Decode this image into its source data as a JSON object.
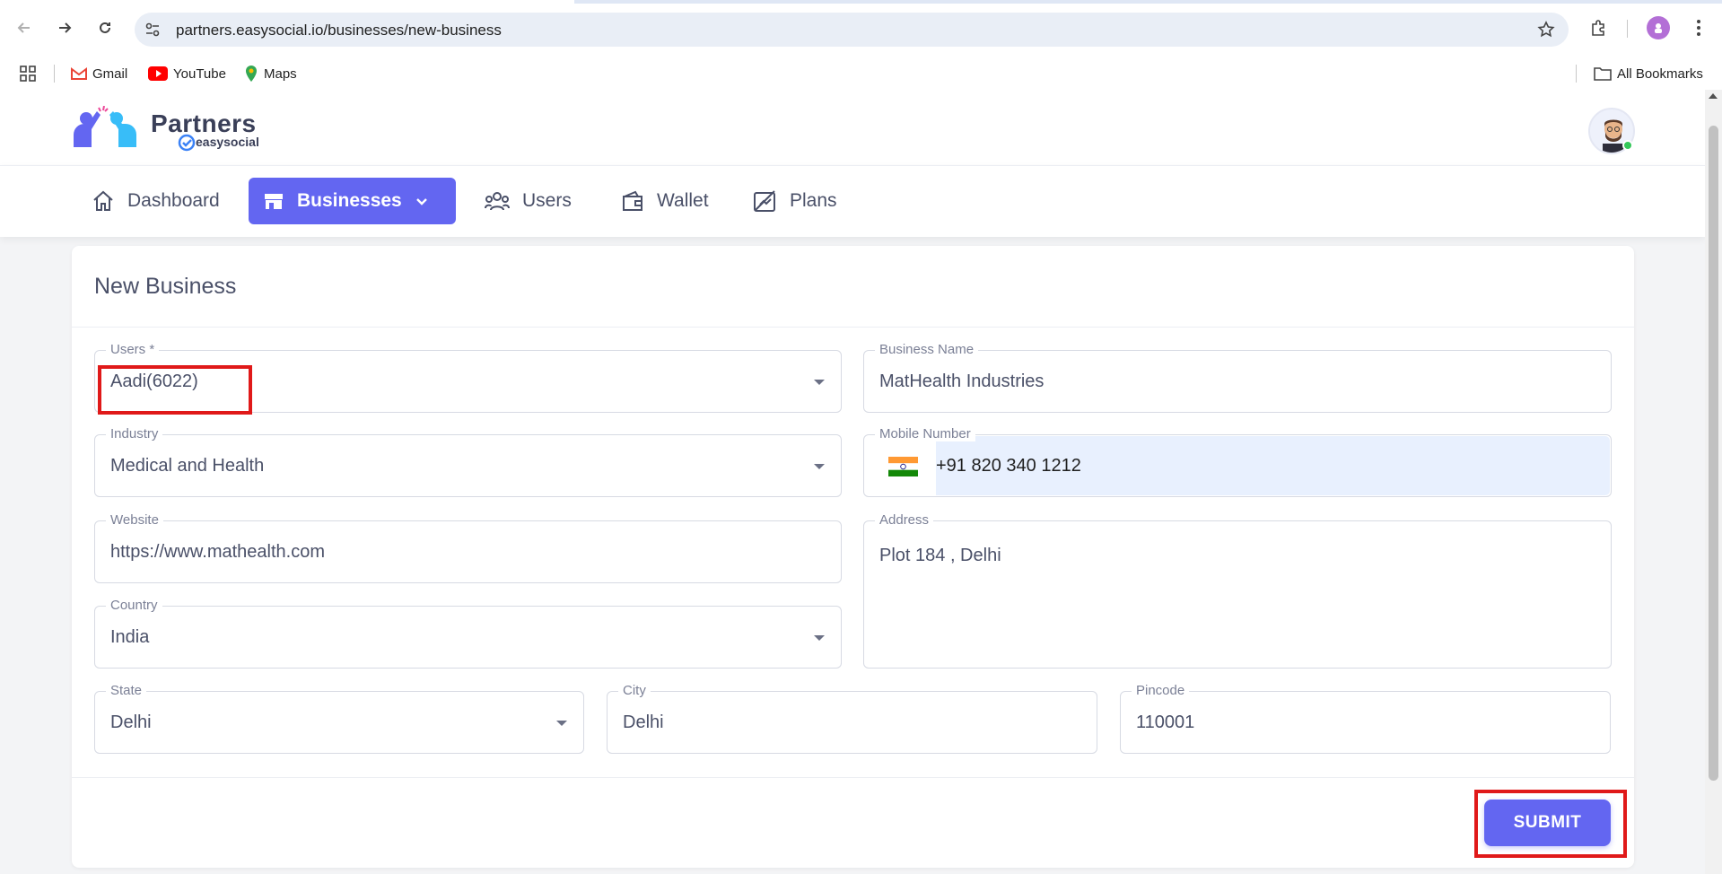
{
  "browser": {
    "url": "partners.easysocial.io/businesses/new-business",
    "bookmarks": [
      {
        "label": "Gmail",
        "icon": "gmail-icon"
      },
      {
        "label": "YouTube",
        "icon": "youtube-icon"
      },
      {
        "label": "Maps",
        "icon": "maps-icon"
      }
    ],
    "all_bookmarks": "All Bookmarks"
  },
  "header": {
    "logo_title": "Partners",
    "logo_subtitle": "easysocial"
  },
  "nav": {
    "items": [
      {
        "label": "Dashboard",
        "icon": "home-icon"
      },
      {
        "label": "Businesses",
        "icon": "store-icon",
        "active": true
      },
      {
        "label": "Users",
        "icon": "users-icon"
      },
      {
        "label": "Wallet",
        "icon": "wallet-icon"
      },
      {
        "label": "Plans",
        "icon": "plans-icon"
      }
    ]
  },
  "form": {
    "title": "New Business",
    "users": {
      "label": "Users *",
      "value": "Aadi(6022)"
    },
    "business_name": {
      "label": "Business Name",
      "value": "MatHealth Industries"
    },
    "industry": {
      "label": "Industry",
      "value": "Medical and Health"
    },
    "mobile": {
      "label": "Mobile Number",
      "value": "+91 820 340 1212"
    },
    "website": {
      "label": "Website",
      "value": "https://www.mathealth.com"
    },
    "address": {
      "label": "Address",
      "value": "Plot 184 , Delhi"
    },
    "country": {
      "label": "Country",
      "value": "India"
    },
    "state": {
      "label": "State",
      "value": "Delhi"
    },
    "city": {
      "label": "City",
      "value": "Delhi"
    },
    "pincode": {
      "label": "Pincode",
      "value": "110001"
    },
    "submit_label": "SUBMIT"
  },
  "colors": {
    "accent": "#6366f1",
    "highlight": "#e01919"
  }
}
